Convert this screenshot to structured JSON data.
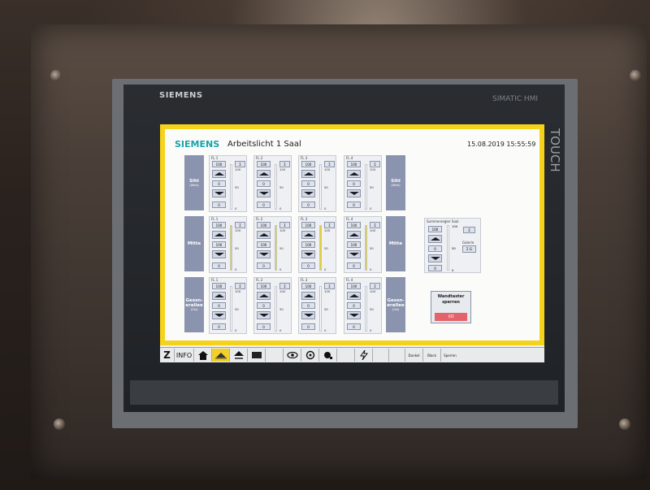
{
  "bezel": {
    "brand": "SIEMENS",
    "product": "SIMATIC HMI",
    "side_label": "TOUCH"
  },
  "header": {
    "brand": "SIEMENS",
    "title": "Arbeitslicht 1 Saal",
    "datetime": "15.08.2019 15:55:59"
  },
  "rows": [
    {
      "label": "Sihl",
      "sublabel": "(West)",
      "right_label": "Sihl",
      "right_sublabel": "(West)",
      "faders": [
        {
          "label": "FL 1",
          "preset": "100",
          "sigma": "Σ",
          "mid": "0",
          "bottom": "0",
          "level": 0
        },
        {
          "label": "FL 2",
          "preset": "100",
          "sigma": "Σ",
          "mid": "0",
          "bottom": "0",
          "level": 0
        },
        {
          "label": "FL 3",
          "preset": "100",
          "sigma": "Σ",
          "mid": "0",
          "bottom": "0",
          "level": 0
        },
        {
          "label": "FL 4",
          "preset": "100",
          "sigma": "Σ",
          "mid": "0",
          "bottom": "0",
          "level": 0
        }
      ]
    },
    {
      "label": "Mitte",
      "sublabel": "",
      "right_label": "Mitte",
      "right_sublabel": "",
      "faders": [
        {
          "label": "FL 1",
          "preset": "100",
          "sigma": "Σ",
          "mid": "100",
          "bottom": "0",
          "level": 1
        },
        {
          "label": "FL 2",
          "preset": "100",
          "sigma": "Σ",
          "mid": "100",
          "bottom": "0",
          "level": 1
        },
        {
          "label": "FL 3",
          "preset": "100",
          "sigma": "Σ",
          "mid": "100",
          "bottom": "0",
          "level": 1
        },
        {
          "label": "FL 4",
          "preset": "100",
          "sigma": "Σ",
          "mid": "100",
          "bottom": "0",
          "level": 1
        }
      ]
    },
    {
      "label": "Gessn-\nerallee",
      "sublabel": "(Ost)",
      "right_label": "Gessn-\nerallee",
      "right_sublabel": "(Ost)",
      "faders": [
        {
          "label": "FL 1",
          "preset": "100",
          "sigma": "Σ",
          "mid": "0",
          "bottom": "0",
          "level": 0
        },
        {
          "label": "FL 2",
          "preset": "100",
          "sigma": "Σ",
          "mid": "0",
          "bottom": "0",
          "level": 0
        },
        {
          "label": "FL 3",
          "preset": "100",
          "sigma": "Σ",
          "mid": "0",
          "bottom": "0",
          "level": 0
        },
        {
          "label": "FL 4",
          "preset": "100",
          "sigma": "Σ",
          "mid": "0",
          "bottom": "0",
          "level": 0
        }
      ]
    }
  ],
  "scale": {
    "top": "100",
    "mid": "50",
    "bottom": "0"
  },
  "summenregler": {
    "title": "Summenregler Saal",
    "preset": "100",
    "sigma": "Σ",
    "mid": "0",
    "bottom": "0",
    "scale_top": "100",
    "scale_mid": "50",
    "scale_bottom": "0",
    "galerie_label": "Galerie",
    "galerie_button": "Σ G"
  },
  "wandtaster": {
    "label": "Wandtaster sperren",
    "button": "I/O"
  },
  "toolbar": {
    "z": "Z",
    "info": "INFO",
    "dunkel": "Dunkel",
    "black": "Black",
    "sperren": "Sperren",
    "icons": [
      "home-icon",
      "worklight-icon",
      "stage-light-icon",
      "screen-icon",
      "eye-icon",
      "gear-icon",
      "spotlight-icon",
      "lightning-icon"
    ]
  },
  "colors": {
    "accent_yellow": "#f6d31b",
    "brand_teal": "#1aa3a8",
    "row_label": "#8b94ae",
    "io_red": "#e4626a"
  }
}
